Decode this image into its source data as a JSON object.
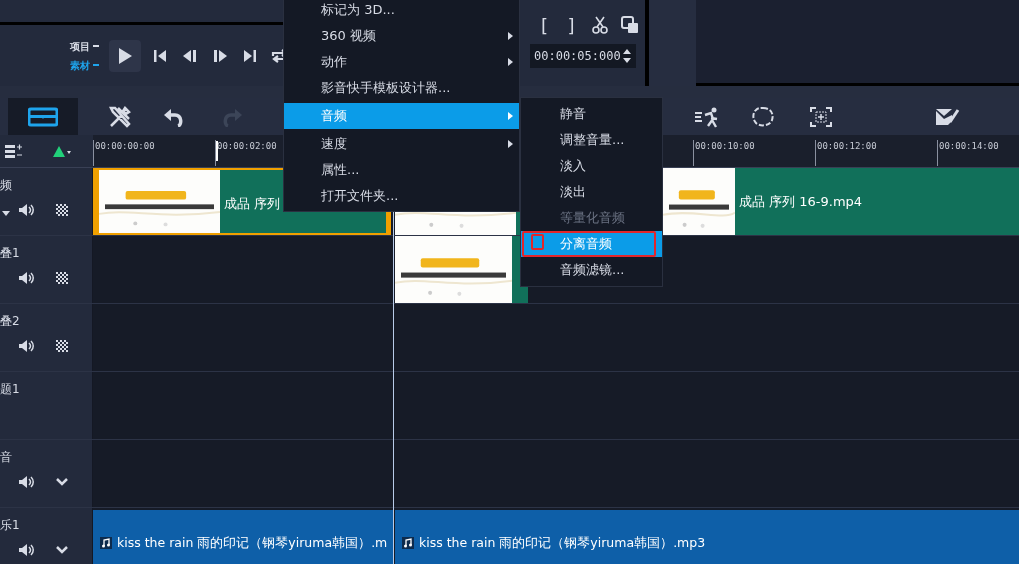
{
  "player": {
    "modes": [
      {
        "label": "项目",
        "selected": false
      },
      {
        "label": "素材",
        "selected": true
      }
    ],
    "buttons": [
      {
        "kind": "play"
      },
      {
        "kind": "start"
      },
      {
        "kind": "prev"
      },
      {
        "kind": "next"
      },
      {
        "kind": "end"
      },
      {
        "kind": "repeat"
      }
    ]
  },
  "trim_panel": {
    "marks": [
      "[",
      "]"
    ],
    "buttons": [
      {
        "kind": "split"
      },
      {
        "kind": "copy"
      }
    ],
    "timecode": "00:00:05:000"
  },
  "toolbar": {
    "tools": [
      {
        "kind": "timeline",
        "selected": true,
        "disabled": false
      },
      {
        "kind": "tools",
        "selected": false,
        "disabled": false
      },
      {
        "kind": "undo",
        "selected": false,
        "disabled": false
      },
      {
        "kind": "redo",
        "selected": false,
        "disabled": true
      }
    ],
    "right_tools": [
      {
        "kind": "motion"
      },
      {
        "kind": "mask"
      },
      {
        "kind": "track"
      },
      {
        "kind": "edit"
      }
    ]
  },
  "ruler": {
    "ticks": [
      "00:00:00:00",
      "00:00:02:00",
      "00:00:10:00",
      "00:00:12:00",
      "00:00:14:00"
    ]
  },
  "tracks": [
    {
      "label": "频",
      "kind": "video",
      "clips": [
        {
          "kind": "video",
          "caption": "成品 序列",
          "selected": true
        },
        {
          "kind": "video",
          "caption": "成品 序列 16-9.mp4",
          "selected": false
        }
      ]
    },
    {
      "label": "叠1",
      "kind": "overlay",
      "clips": [
        {
          "kind": "video",
          "selected": false
        }
      ]
    },
    {
      "label": "叠2",
      "kind": "overlay"
    },
    {
      "label": "题1",
      "kind": "title"
    },
    {
      "label": "音",
      "kind": "voice"
    },
    {
      "label": "乐1",
      "kind": "music",
      "clips": [
        {
          "kind": "audio",
          "caption": "kiss the rain 雨的印记（钢琴yiruma韩国）.m",
          "selected": false
        },
        {
          "kind": "audio",
          "caption": "kiss the rain 雨的印记（钢琴yiruma韩国）.mp3",
          "selected": false
        }
      ]
    }
  ],
  "context_menu": {
    "items": [
      {
        "label": "标记为 3D...",
        "submenu": false,
        "selected": false
      },
      {
        "label": "360 视频",
        "submenu": true,
        "selected": false
      },
      {
        "label": "动作",
        "submenu": true,
        "selected": false
      },
      {
        "label": "影音快手模板设计器...",
        "submenu": false,
        "selected": false
      },
      {
        "label": "音频",
        "submenu": true,
        "selected": true
      },
      {
        "label": "速度",
        "submenu": true,
        "selected": false
      },
      {
        "label": "属性...",
        "submenu": false,
        "selected": false
      },
      {
        "label": "打开文件夹...",
        "submenu": false,
        "selected": false
      }
    ],
    "submenu": {
      "items": [
        {
          "label": "静音",
          "selected": false,
          "disabled": false,
          "highlighted": false
        },
        {
          "label": "调整音量...",
          "selected": false,
          "disabled": false,
          "highlighted": false
        },
        {
          "label": "淡入",
          "selected": false,
          "disabled": false,
          "highlighted": false
        },
        {
          "label": "淡出",
          "selected": false,
          "disabled": false,
          "highlighted": false
        },
        {
          "label": "等量化音频",
          "selected": false,
          "disabled": true,
          "highlighted": false
        },
        {
          "label": "分离音频",
          "selected": true,
          "disabled": false,
          "highlighted": true
        },
        {
          "label": "音频滤镜...",
          "selected": false,
          "disabled": false,
          "highlighted": false
        }
      ]
    }
  }
}
